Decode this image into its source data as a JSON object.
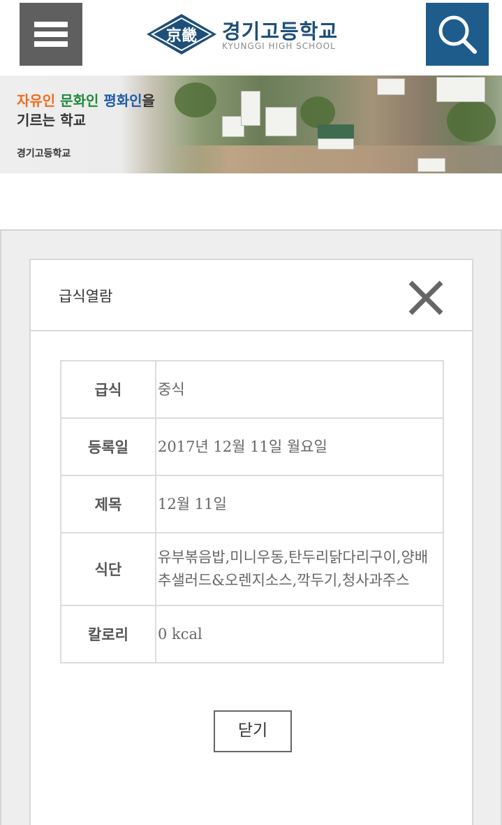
{
  "header": {
    "logo_title": "경기고등학교",
    "logo_subtitle": "KYUNGGI HIGH SCHOOL",
    "emblem_text": "京畿"
  },
  "banner": {
    "slogan_part1": "자유인 ",
    "slogan_part2": "문화인 ",
    "slogan_part3": "평화인",
    "slogan_part4": "을",
    "slogan_line2": "기르는 학교",
    "school_name": "경기고등학교"
  },
  "modal": {
    "title": "급식열람",
    "close_label": "닫기",
    "rows": [
      {
        "label": "급식",
        "value": "중식"
      },
      {
        "label": "등록일",
        "value": "2017년 12월 11일 월요일"
      },
      {
        "label": "제목",
        "value": "12월 11일"
      },
      {
        "label": "식단",
        "value": "유부볶음밥,미니우동,탄두리닭다리구이,양배추샐러드&오렌지소스,깍두기,청사과주스"
      },
      {
        "label": "칼로리",
        "value": "0 kcal"
      }
    ]
  },
  "colors": {
    "menu_button": "#5f5f5f",
    "search_button": "#1e5c8c",
    "logo_blue": "#1e4f78",
    "slogan_orange": "#f26b1d",
    "slogan_green": "#1e8a3a",
    "slogan_blue": "#1e5aa8"
  },
  "icons": {
    "menu": "hamburger-menu-icon",
    "search": "search-icon",
    "close": "close-icon"
  }
}
